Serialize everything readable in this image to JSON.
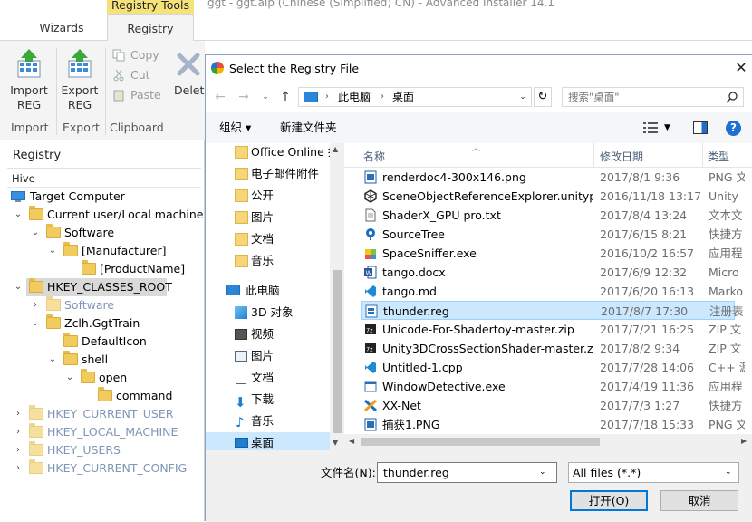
{
  "app": {
    "title": "ggt - ggt.aip (Chinese (Simplified) CN) - Advanced Installer 14.1",
    "context_tab": "Registry Tools"
  },
  "ribbon": {
    "tabs": [
      "Wizards",
      "Registry"
    ],
    "import_label_1": "Import",
    "import_label_2": "REG",
    "export_label_1": "Export",
    "export_label_2": "REG",
    "copy": "Copy",
    "cut": "Cut",
    "paste": "Paste",
    "delete": "Delete",
    "groups": {
      "import": "Import",
      "export": "Export",
      "clipboard": "Clipboard"
    }
  },
  "registry": {
    "header": "Registry",
    "hive_header": "Hive",
    "tree": [
      "Target Computer",
      "Current user/Local machine",
      "Software",
      "[Manufacturer]",
      "[ProductName]",
      "HKEY_CLASSES_ROOT",
      "Software",
      "Zclh.GgtTrain",
      "DefaultIcon",
      "shell",
      "open",
      "command",
      "HKEY_CURRENT_USER",
      "HKEY_LOCAL_MACHINE",
      "HKEY_USERS",
      "HKEY_CURRENT_CONFIG"
    ]
  },
  "dialog": {
    "title": "Select the Registry File",
    "address": {
      "crumb_1": "此电脑",
      "crumb_2": "桌面"
    },
    "search_placeholder": "搜索\"桌面\"",
    "toolbar": {
      "organize": "组织 ▾",
      "new_folder": "新建文件夹"
    },
    "nav_tree": [
      "Office Online 扩",
      "电子邮件附件",
      "公开",
      "图片",
      "文档",
      "音乐",
      "此电脑",
      "3D 对象",
      "视频",
      "图片",
      "文档",
      "下载",
      "音乐",
      "桌面"
    ],
    "columns": {
      "name": "名称",
      "date": "修改日期",
      "type": "类型"
    },
    "files": [
      {
        "name": "renderdoc4-300x146.png",
        "date": "2017/8/1 9:36",
        "type": "PNG 文",
        "icon": "image-icon"
      },
      {
        "name": "SceneObjectReferenceExplorer.unityp...",
        "date": "2016/11/18 13:17",
        "type": "Unity",
        "icon": "unity-icon"
      },
      {
        "name": "ShaderX_GPU pro.txt",
        "date": "2017/8/4 13:24",
        "type": "文本文",
        "icon": "text-file-icon"
      },
      {
        "name": "SourceTree",
        "date": "2017/6/15 8:21",
        "type": "快捷方",
        "icon": "sourcetree-icon"
      },
      {
        "name": "SpaceSniffer.exe",
        "date": "2016/10/2 16:57",
        "type": "应用程",
        "icon": "puzzle-icon"
      },
      {
        "name": "tango.docx",
        "date": "2017/6/9 12:32",
        "type": "Micro",
        "icon": "word-icon"
      },
      {
        "name": "tango.md",
        "date": "2017/6/20 16:13",
        "type": "Marko",
        "icon": "vscode-icon"
      },
      {
        "name": "thunder.reg",
        "date": "2017/8/7 17:30",
        "type": "注册表",
        "icon": "reg-file-icon"
      },
      {
        "name": "Unicode-For-Shadertoy-master.zip",
        "date": "2017/7/21 16:25",
        "type": "ZIP 文",
        "icon": "zip-icon"
      },
      {
        "name": "Unity3DCrossSectionShader-master.zip",
        "date": "2017/8/2 9:34",
        "type": "ZIP 文",
        "icon": "zip-icon"
      },
      {
        "name": "Untitled-1.cpp",
        "date": "2017/7/28 14:06",
        "type": "C++ 源",
        "icon": "vscode-icon"
      },
      {
        "name": "WindowDetective.exe",
        "date": "2017/4/19 11:36",
        "type": "应用程",
        "icon": "window-icon"
      },
      {
        "name": "XX-Net",
        "date": "2017/7/3 1:27",
        "type": "快捷方",
        "icon": "xxnet-icon"
      },
      {
        "name": "捕获1.PNG",
        "date": "2017/7/18 15:33",
        "type": "PNG 文",
        "icon": "image-icon"
      }
    ],
    "selected_file_index": 7,
    "filename_label": "文件名(N):",
    "filename_value": "thunder.reg",
    "filetype_value": "All files (*.*)",
    "open_button": "打开(O)",
    "cancel_button": "取消"
  },
  "colors": {
    "context_tab_bg": "#f6e27a",
    "selection_bg": "#cce8ff",
    "selection_border": "#99d1ff",
    "accent_blue": "#0078d7",
    "folder_yellow": "#f2cb5e"
  }
}
